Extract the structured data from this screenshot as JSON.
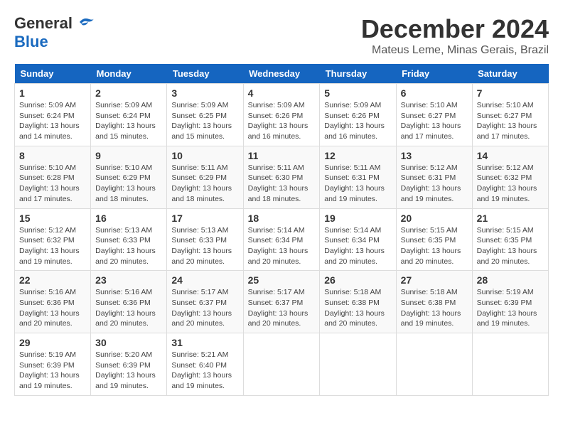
{
  "header": {
    "logo_general": "General",
    "logo_blue": "Blue",
    "month_title": "December 2024",
    "location": "Mateus Leme, Minas Gerais, Brazil"
  },
  "weekdays": [
    "Sunday",
    "Monday",
    "Tuesday",
    "Wednesday",
    "Thursday",
    "Friday",
    "Saturday"
  ],
  "weeks": [
    [
      {
        "day": "1",
        "sunrise": "5:09 AM",
        "sunset": "6:24 PM",
        "daylight": "13 hours and 14 minutes."
      },
      {
        "day": "2",
        "sunrise": "5:09 AM",
        "sunset": "6:24 PM",
        "daylight": "13 hours and 15 minutes."
      },
      {
        "day": "3",
        "sunrise": "5:09 AM",
        "sunset": "6:25 PM",
        "daylight": "13 hours and 15 minutes."
      },
      {
        "day": "4",
        "sunrise": "5:09 AM",
        "sunset": "6:26 PM",
        "daylight": "13 hours and 16 minutes."
      },
      {
        "day": "5",
        "sunrise": "5:09 AM",
        "sunset": "6:26 PM",
        "daylight": "13 hours and 16 minutes."
      },
      {
        "day": "6",
        "sunrise": "5:10 AM",
        "sunset": "6:27 PM",
        "daylight": "13 hours and 17 minutes."
      },
      {
        "day": "7",
        "sunrise": "5:10 AM",
        "sunset": "6:27 PM",
        "daylight": "13 hours and 17 minutes."
      }
    ],
    [
      {
        "day": "8",
        "sunrise": "5:10 AM",
        "sunset": "6:28 PM",
        "daylight": "13 hours and 17 minutes."
      },
      {
        "day": "9",
        "sunrise": "5:10 AM",
        "sunset": "6:29 PM",
        "daylight": "13 hours and 18 minutes."
      },
      {
        "day": "10",
        "sunrise": "5:11 AM",
        "sunset": "6:29 PM",
        "daylight": "13 hours and 18 minutes."
      },
      {
        "day": "11",
        "sunrise": "5:11 AM",
        "sunset": "6:30 PM",
        "daylight": "13 hours and 18 minutes."
      },
      {
        "day": "12",
        "sunrise": "5:11 AM",
        "sunset": "6:31 PM",
        "daylight": "13 hours and 19 minutes."
      },
      {
        "day": "13",
        "sunrise": "5:12 AM",
        "sunset": "6:31 PM",
        "daylight": "13 hours and 19 minutes."
      },
      {
        "day": "14",
        "sunrise": "5:12 AM",
        "sunset": "6:32 PM",
        "daylight": "13 hours and 19 minutes."
      }
    ],
    [
      {
        "day": "15",
        "sunrise": "5:12 AM",
        "sunset": "6:32 PM",
        "daylight": "13 hours and 19 minutes."
      },
      {
        "day": "16",
        "sunrise": "5:13 AM",
        "sunset": "6:33 PM",
        "daylight": "13 hours and 20 minutes."
      },
      {
        "day": "17",
        "sunrise": "5:13 AM",
        "sunset": "6:33 PM",
        "daylight": "13 hours and 20 minutes."
      },
      {
        "day": "18",
        "sunrise": "5:14 AM",
        "sunset": "6:34 PM",
        "daylight": "13 hours and 20 minutes."
      },
      {
        "day": "19",
        "sunrise": "5:14 AM",
        "sunset": "6:34 PM",
        "daylight": "13 hours and 20 minutes."
      },
      {
        "day": "20",
        "sunrise": "5:15 AM",
        "sunset": "6:35 PM",
        "daylight": "13 hours and 20 minutes."
      },
      {
        "day": "21",
        "sunrise": "5:15 AM",
        "sunset": "6:35 PM",
        "daylight": "13 hours and 20 minutes."
      }
    ],
    [
      {
        "day": "22",
        "sunrise": "5:16 AM",
        "sunset": "6:36 PM",
        "daylight": "13 hours and 20 minutes."
      },
      {
        "day": "23",
        "sunrise": "5:16 AM",
        "sunset": "6:36 PM",
        "daylight": "13 hours and 20 minutes."
      },
      {
        "day": "24",
        "sunrise": "5:17 AM",
        "sunset": "6:37 PM",
        "daylight": "13 hours and 20 minutes."
      },
      {
        "day": "25",
        "sunrise": "5:17 AM",
        "sunset": "6:37 PM",
        "daylight": "13 hours and 20 minutes."
      },
      {
        "day": "26",
        "sunrise": "5:18 AM",
        "sunset": "6:38 PM",
        "daylight": "13 hours and 20 minutes."
      },
      {
        "day": "27",
        "sunrise": "5:18 AM",
        "sunset": "6:38 PM",
        "daylight": "13 hours and 19 minutes."
      },
      {
        "day": "28",
        "sunrise": "5:19 AM",
        "sunset": "6:39 PM",
        "daylight": "13 hours and 19 minutes."
      }
    ],
    [
      {
        "day": "29",
        "sunrise": "5:19 AM",
        "sunset": "6:39 PM",
        "daylight": "13 hours and 19 minutes."
      },
      {
        "day": "30",
        "sunrise": "5:20 AM",
        "sunset": "6:39 PM",
        "daylight": "13 hours and 19 minutes."
      },
      {
        "day": "31",
        "sunrise": "5:21 AM",
        "sunset": "6:40 PM",
        "daylight": "13 hours and 19 minutes."
      },
      null,
      null,
      null,
      null
    ]
  ]
}
